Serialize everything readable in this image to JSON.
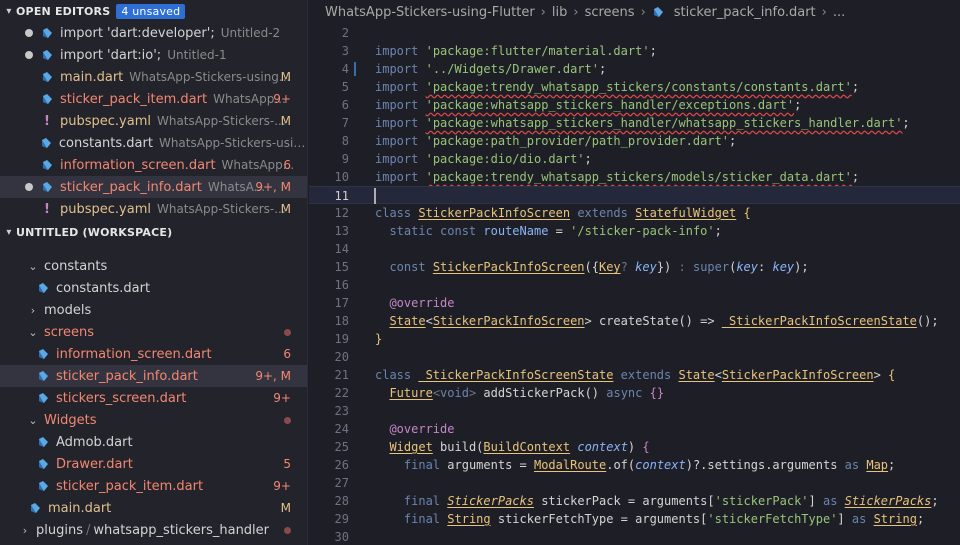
{
  "open_editors": {
    "title": "OPEN EDITORS",
    "badge": "4 unsaved",
    "items": [
      {
        "name": "import 'dart:developer';",
        "desc": "Untitled-2",
        "status": "",
        "dirty": true
      },
      {
        "name": "import 'dart:io';",
        "desc": "Untitled-1",
        "status": "",
        "dirty": true
      },
      {
        "name": "main.dart",
        "desc": "WhatsApp-Stickers-using...",
        "status": "M"
      },
      {
        "name": "sticker_pack_item.dart",
        "desc": "WhatsApp...",
        "status": "9+"
      },
      {
        "name": "pubspec.yaml",
        "desc": "WhatsApp-Stickers-...",
        "status": "M"
      },
      {
        "name": "constants.dart",
        "desc": "WhatsApp-Stickers-using...",
        "status": ""
      },
      {
        "name": "information_screen.dart",
        "desc": "WhatsApp...",
        "status": "6"
      },
      {
        "name": "sticker_pack_info.dart",
        "desc": "WhatsA...",
        "status": "9+, M",
        "dirty": true
      },
      {
        "name": "pubspec.yaml",
        "desc": "WhatsApp-Stickers-...",
        "status": "M"
      }
    ]
  },
  "workspace": {
    "title": "UNTITLED (WORKSPACE)",
    "items": [
      {
        "name": "constants"
      },
      {
        "name": "constants.dart"
      },
      {
        "name": "models"
      },
      {
        "name": "screens"
      },
      {
        "name": "information_screen.dart",
        "status": "6"
      },
      {
        "name": "sticker_pack_info.dart",
        "status": "9+, M"
      },
      {
        "name": "stickers_screen.dart",
        "status": "9+"
      },
      {
        "name": "Widgets"
      },
      {
        "name": "Admob.dart"
      },
      {
        "name": "Drawer.dart",
        "status": "5"
      },
      {
        "name": "sticker_pack_item.dart",
        "status": "9+"
      },
      {
        "name": "main.dart",
        "status": "M"
      },
      {
        "name": "plugins",
        "sub": "whatsapp_stickers_handler"
      }
    ]
  },
  "breadcrumb": {
    "parts": [
      "WhatsApp-Stickers-using-Flutter",
      "lib",
      "screens",
      "sticker_pack_info.dart",
      "..."
    ]
  },
  "code": {
    "line_numbers": [
      "2",
      "3",
      "4",
      "5",
      "6",
      "7",
      "8",
      "9",
      "10",
      "11",
      "12",
      "13",
      "14",
      "15",
      "16",
      "17",
      "18",
      "19",
      "20",
      "21",
      "22",
      "23",
      "24",
      "25",
      "26",
      "27",
      "28",
      "29",
      "30"
    ]
  },
  "colors": {
    "accent": "#2e6fd6",
    "modified": "#e2c08d",
    "error": "#f48771",
    "string": "#98c379",
    "keyword": "#6b84b0",
    "class": "#e8c37a"
  }
}
